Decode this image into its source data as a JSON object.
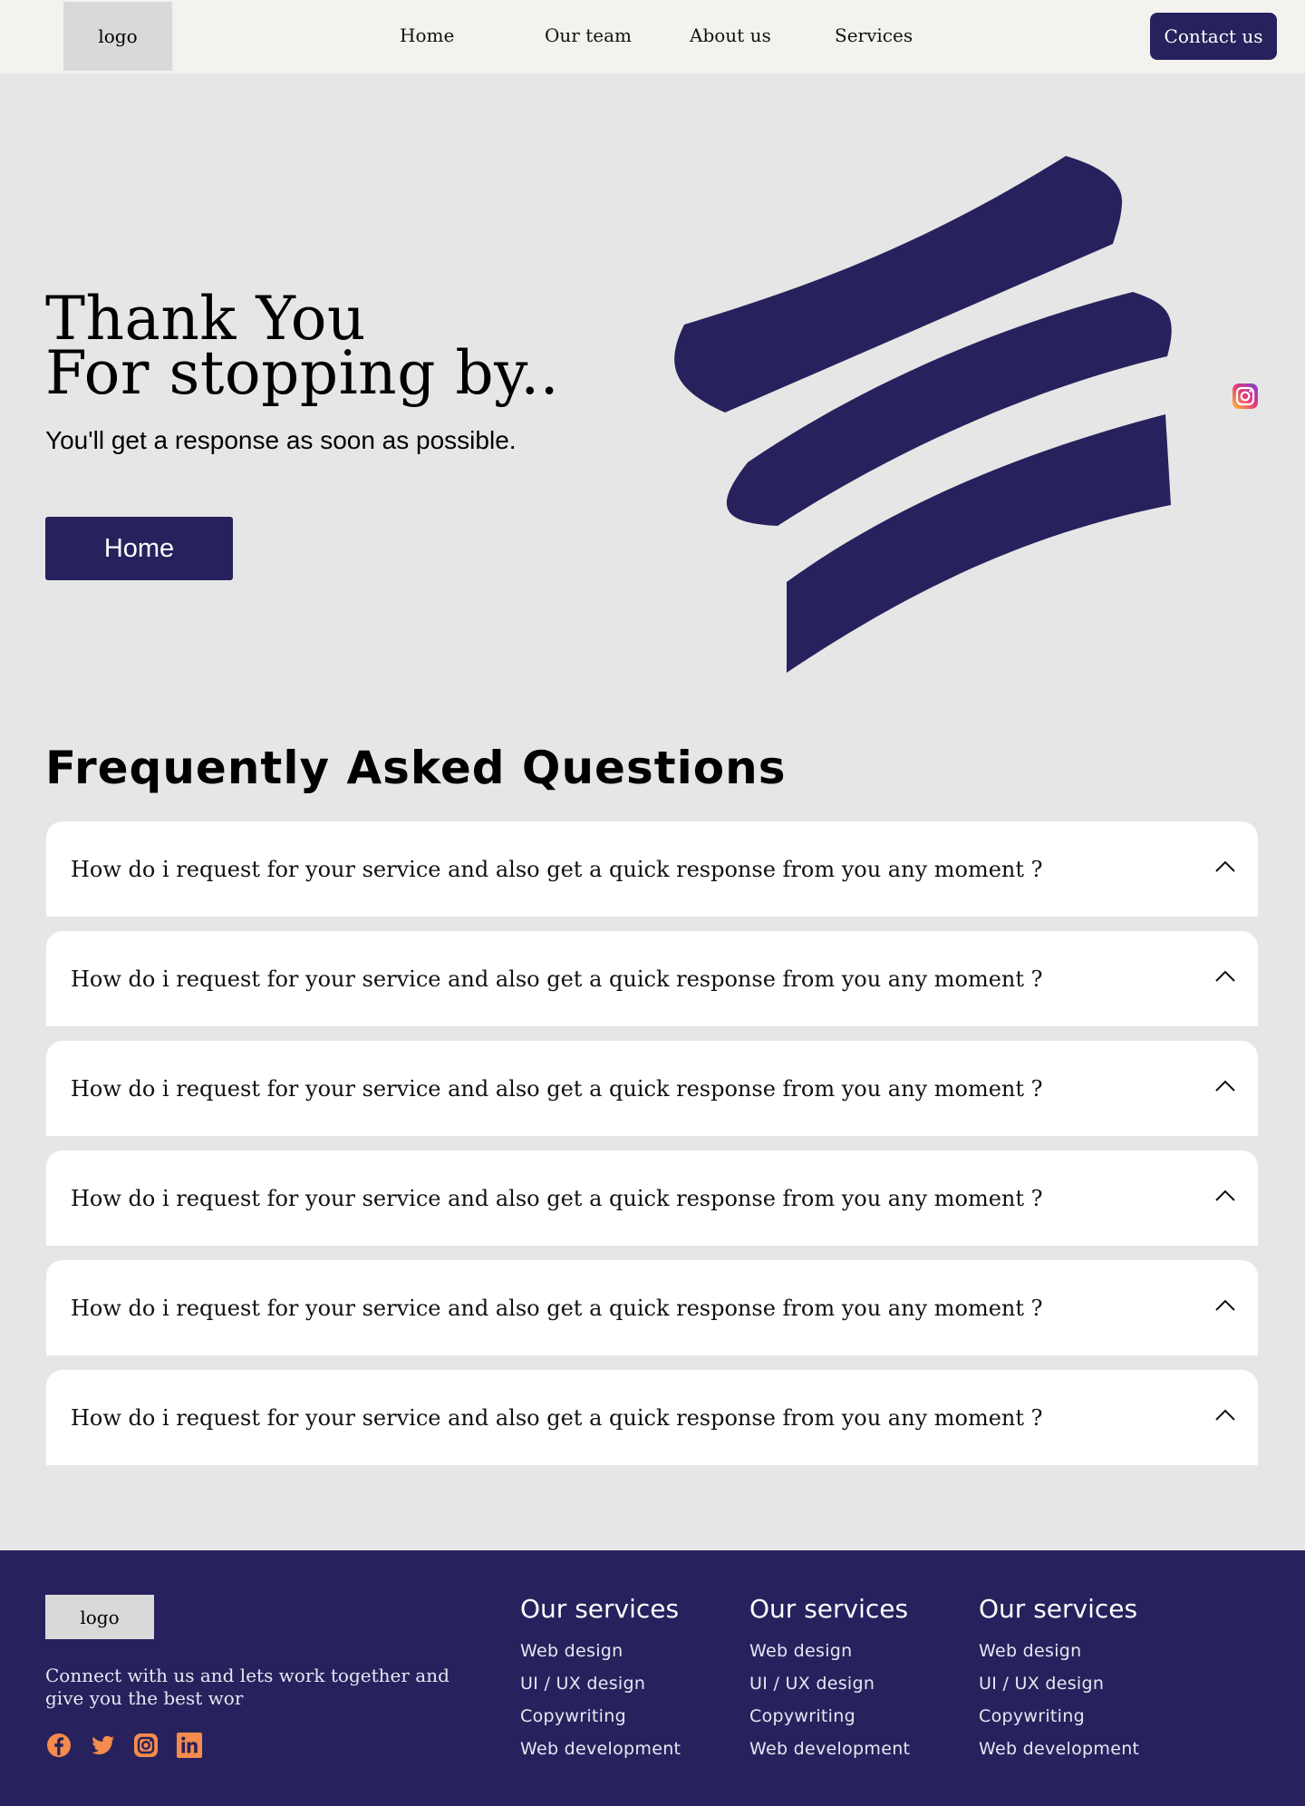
{
  "nav": {
    "logo": "logo",
    "links": [
      "Home",
      "Our team",
      "About us",
      "Services"
    ],
    "contact": "Contact us"
  },
  "hero": {
    "title_line1": "Thank You",
    "title_line2": "For stopping by..",
    "subtitle": "You'll get a response as soon as possible.",
    "button": "Home"
  },
  "faq": {
    "title": "Frequently Asked Questions",
    "items": [
      "How do i request for your service and also get a quick response from you any moment ?",
      "How do i request for your service and also get a quick response from you any moment ?",
      "How do i request for your service and also get a quick response from you any moment ?",
      "How do i request for your service and also get a quick response from you any moment ?",
      "How do i request for your service and also get a quick response from you any moment ?",
      "How do i request for your service and also get a quick response from you any moment ?"
    ]
  },
  "footer": {
    "logo": "logo",
    "tagline": "Connect with us and lets work together and give you the best wor",
    "socials": [
      "facebook-icon",
      "twitter-icon",
      "instagram-icon",
      "linkedin-icon"
    ],
    "columns": [
      {
        "heading": "Our services",
        "items": [
          "Web design",
          "UI / UX design",
          "Copywriting",
          "Web development"
        ]
      },
      {
        "heading": "Our services",
        "items": [
          "Web design",
          "UI / UX design",
          "Copywriting",
          "Web development"
        ]
      },
      {
        "heading": "Our services",
        "items": [
          "Web design",
          "UI / UX design",
          "Copywriting",
          "Web development"
        ]
      }
    ]
  },
  "colors": {
    "brand": "#27225d",
    "background": "#e6e6e6",
    "nav_background": "#f3f2ef",
    "social_icon": "#f58b4c"
  }
}
